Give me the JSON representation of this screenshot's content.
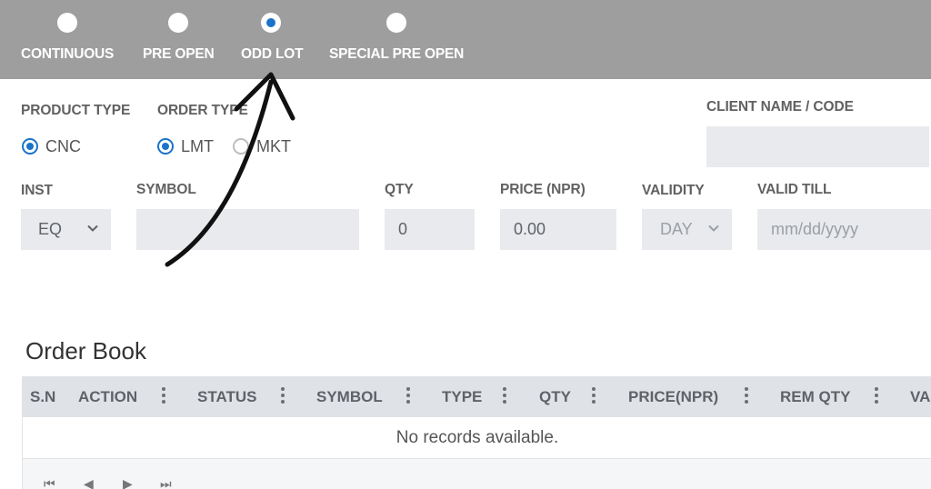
{
  "session_tabs": [
    {
      "label": "CONTINUOUS",
      "selected": false
    },
    {
      "label": "PRE OPEN",
      "selected": false
    },
    {
      "label": "ODD LOT",
      "selected": true
    },
    {
      "label": "SPECIAL PRE OPEN",
      "selected": false
    }
  ],
  "form": {
    "product_type_label": "PRODUCT TYPE",
    "product_cnc": "CNC",
    "order_type_label": "ORDER TYPE",
    "order_lmt": "LMT",
    "order_mkt": "MKT",
    "client_label": "CLIENT NAME / CODE",
    "inst_label": "INST",
    "inst_value": "EQ",
    "symbol_label": "SYMBOL",
    "qty_label": "QTY",
    "qty_value": "0",
    "price_label": "PRICE (NPR)",
    "price_value": "0.00",
    "validity_label": "VALIDITY",
    "validity_value": "DAY",
    "valid_till_label": "VALID TILL",
    "valid_till_placeholder": "mm/dd/yyyy"
  },
  "order_book": {
    "title": "Order Book",
    "columns": [
      "S.N",
      "ACTION",
      "STATUS",
      "SYMBOL",
      "TYPE",
      "QTY",
      "PRICE(NPR)",
      "REM QTY",
      "VA"
    ],
    "empty_text": "No records available."
  },
  "colors": {
    "topbar": "#9e9e9e",
    "accent": "#1a73c9",
    "field_bg": "#e8eaed"
  }
}
